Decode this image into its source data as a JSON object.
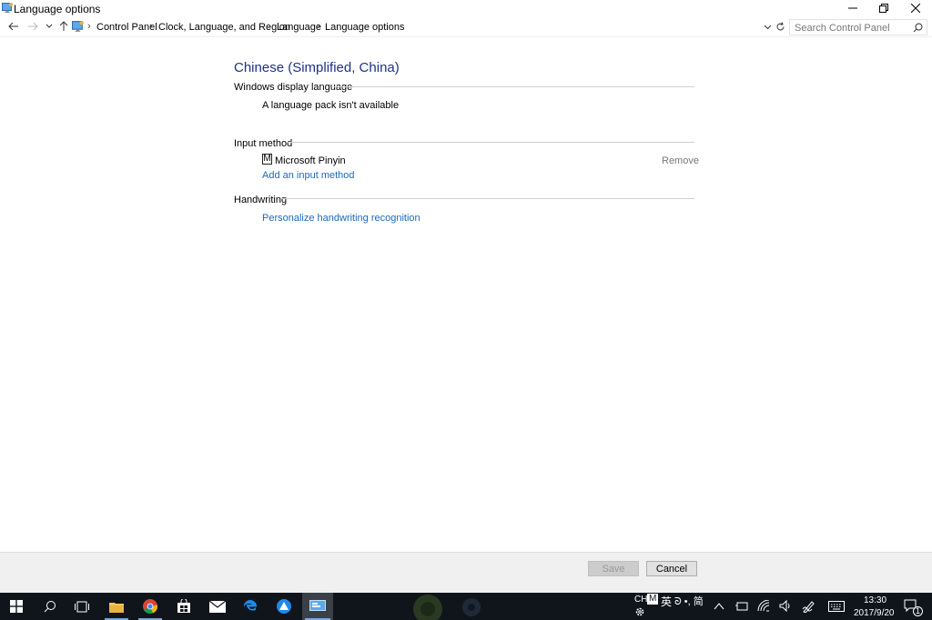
{
  "window": {
    "title": "Language options",
    "controls": [
      "minimize",
      "restore",
      "close"
    ]
  },
  "address_bar": {
    "breadcrumbs": [
      "Control Panel",
      "Clock, Language, and Region",
      "Language",
      "Language options"
    ],
    "search_placeholder": "Search Control Panel"
  },
  "content": {
    "language_title": "Chinese (Simplified, China)",
    "display_language": {
      "heading": "Windows display language",
      "status": "A language pack isn't available"
    },
    "input_method": {
      "heading": "Input method",
      "items": [
        {
          "icon": "M",
          "name": "Microsoft Pinyin",
          "action": "Remove"
        }
      ],
      "add_link": "Add an input method"
    },
    "handwriting": {
      "heading": "Handwriting",
      "link": "Personalize handwriting recognition"
    }
  },
  "footer": {
    "save_label": "Save",
    "cancel_label": "Cancel"
  },
  "taskbar": {
    "apps": [
      "start-icon",
      "search-icon",
      "task-view-icon",
      "file-explorer-icon",
      "chrome-icon",
      "store-icon",
      "mail-icon",
      "edge-icon",
      "app-icon",
      "control-panel-icon"
    ],
    "tray": {
      "lang": "CH",
      "ime_letter": "M",
      "ime_mode": "英",
      "ime_extra": "ᘐ •, 简",
      "time": "13:30",
      "date": "2017/9/20",
      "notifications": "1"
    }
  },
  "colors": {
    "heading_blue": "#1e3287",
    "link_blue": "#1a6ac2",
    "taskbar": "#10151c"
  }
}
